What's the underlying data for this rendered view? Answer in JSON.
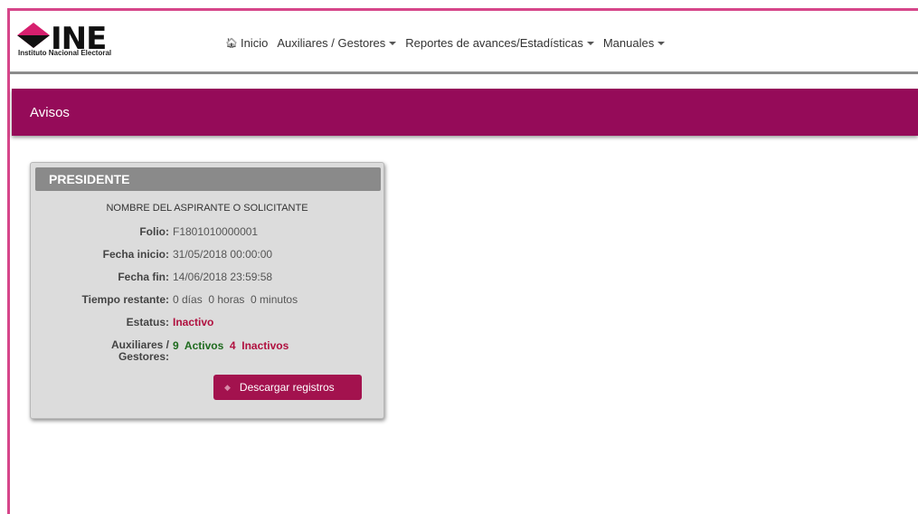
{
  "logo": {
    "text": "INE",
    "subtitle": "Instituto Nacional Electoral"
  },
  "nav": {
    "home": "Inicio",
    "items": [
      {
        "label": "Auxiliares / Gestores"
      },
      {
        "label": "Reportes de avances/Estadísticas"
      },
      {
        "label": "Manuales"
      }
    ]
  },
  "avisos": {
    "title": "Avisos"
  },
  "card": {
    "title": "PRESIDENTE",
    "aspirante": "NOMBRE DEL ASPIRANTE O SOLICITANTE",
    "folio_label": "Folio:",
    "folio": "F1801010000001",
    "fecha_inicio_label": "Fecha inicio:",
    "fecha_inicio": "31/05/2018 00:00:00",
    "fecha_fin_label": "Fecha fin:",
    "fecha_fin": "14/06/2018 23:59:58",
    "tiempo_label": "Tiempo restante:",
    "tiempo": "0 días  0 horas  0 minutos",
    "estatus_label": "Estatus:",
    "estatus": "Inactivo",
    "aux_label_1": "Auxiliares /",
    "aux_label_2": "Gestores:",
    "activos": "9  Activos",
    "inactivos": "4  Inactivos",
    "download_button": "Descargar registros"
  },
  "colors": {
    "brand": "#950b59",
    "frame": "#d6468a",
    "button": "#a3124e",
    "status_red": "#b0103f",
    "status_green": "#1f6b1f"
  }
}
